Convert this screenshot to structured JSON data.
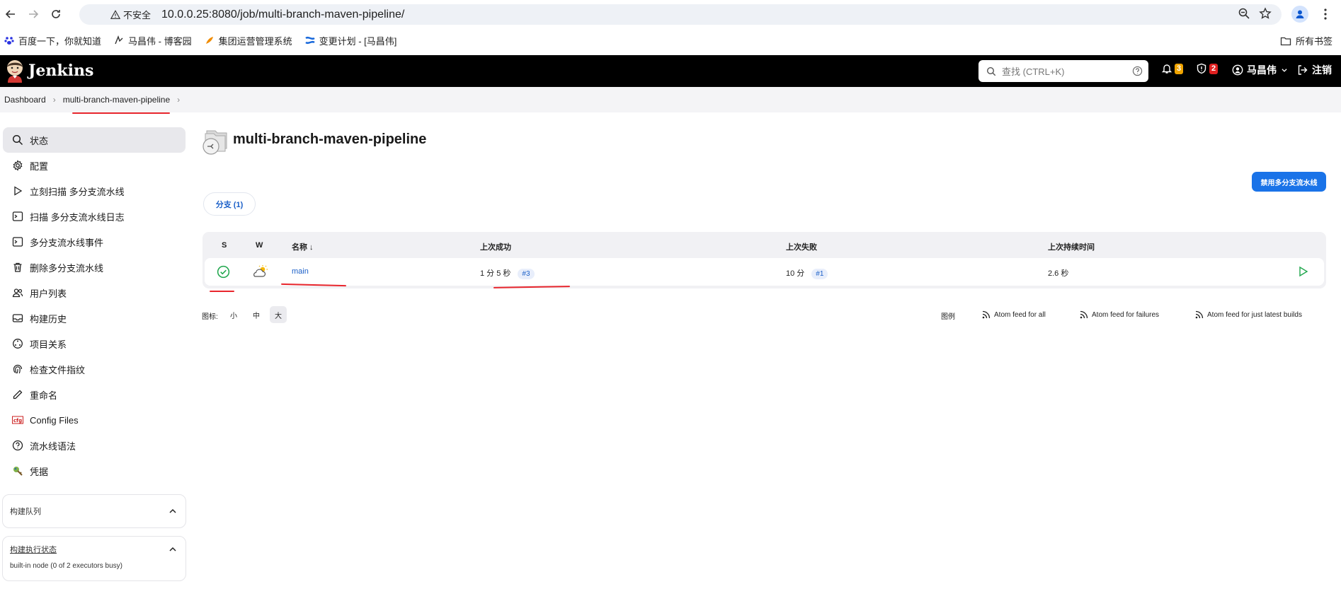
{
  "browser": {
    "security_label": "不安全",
    "url": "10.0.0.25:8080/job/multi-branch-maven-pipeline/"
  },
  "bookmarks": {
    "items": [
      "百度一下，你就知道",
      "马昌伟 - 博客园",
      "集团运营管理系统",
      "变更计划 - [马昌伟]"
    ],
    "all_label": "所有书签"
  },
  "header": {
    "logo_text": "Jenkins",
    "search_placeholder": "查找 (CTRL+K)",
    "notifications_count": "3",
    "security_count": "2",
    "user_name": "马昌伟",
    "logout_label": "注销"
  },
  "breadcrumb": {
    "items": [
      "Dashboard",
      "multi-branch-maven-pipeline"
    ]
  },
  "sidebar": {
    "items": [
      {
        "label": "状态",
        "icon": "search-icon"
      },
      {
        "label": "配置",
        "icon": "gear-icon"
      },
      {
        "label": "立刻扫描 多分支流水线",
        "icon": "play-icon"
      },
      {
        "label": "扫描 多分支流水线日志",
        "icon": "terminal-icon"
      },
      {
        "label": "多分支流水线事件",
        "icon": "terminal-icon"
      },
      {
        "label": "删除多分支流水线",
        "icon": "trash-icon"
      },
      {
        "label": "用户列表",
        "icon": "people-icon"
      },
      {
        "label": "构建历史",
        "icon": "history-icon"
      },
      {
        "label": "项目关系",
        "icon": "relations-icon"
      },
      {
        "label": "检查文件指纹",
        "icon": "fingerprint-icon"
      },
      {
        "label": "重命名",
        "icon": "pencil-icon"
      },
      {
        "label": "Config Files",
        "icon": "cfg-icon"
      },
      {
        "label": "流水线语法",
        "icon": "help-icon"
      },
      {
        "label": "凭据",
        "icon": "credentials-icon"
      }
    ],
    "build_queue_label": "构建队列",
    "executor_status_label": "构建执行状态",
    "executor_text": "built-in node (0 of 2 executors busy)"
  },
  "main": {
    "title": "multi-branch-maven-pipeline",
    "disable_button": "禁用多分支流水线",
    "tab_label": "分支 (1)",
    "columns": {
      "s": "S",
      "w": "W",
      "name": "名称 ↓",
      "last_success": "上次成功",
      "last_failure": "上次失败",
      "last_duration": "上次持续时间"
    },
    "rows": [
      {
        "name": "main",
        "last_success": "1 分 5 秒",
        "success_build": "#3",
        "last_failure": "10 分",
        "failure_build": "#1",
        "duration": "2.6 秒"
      }
    ],
    "icon_size_label": "图标:",
    "sizes": [
      "小",
      "中",
      "大"
    ],
    "legend_label": "图例",
    "feeds": [
      "Atom feed for all",
      "Atom feed for failures",
      "Atom feed for just latest builds"
    ]
  },
  "colors": {
    "accent": "#1a73e8",
    "header_bg": "#000000",
    "success": "#1ea64b",
    "annotation": "#e8262d"
  }
}
